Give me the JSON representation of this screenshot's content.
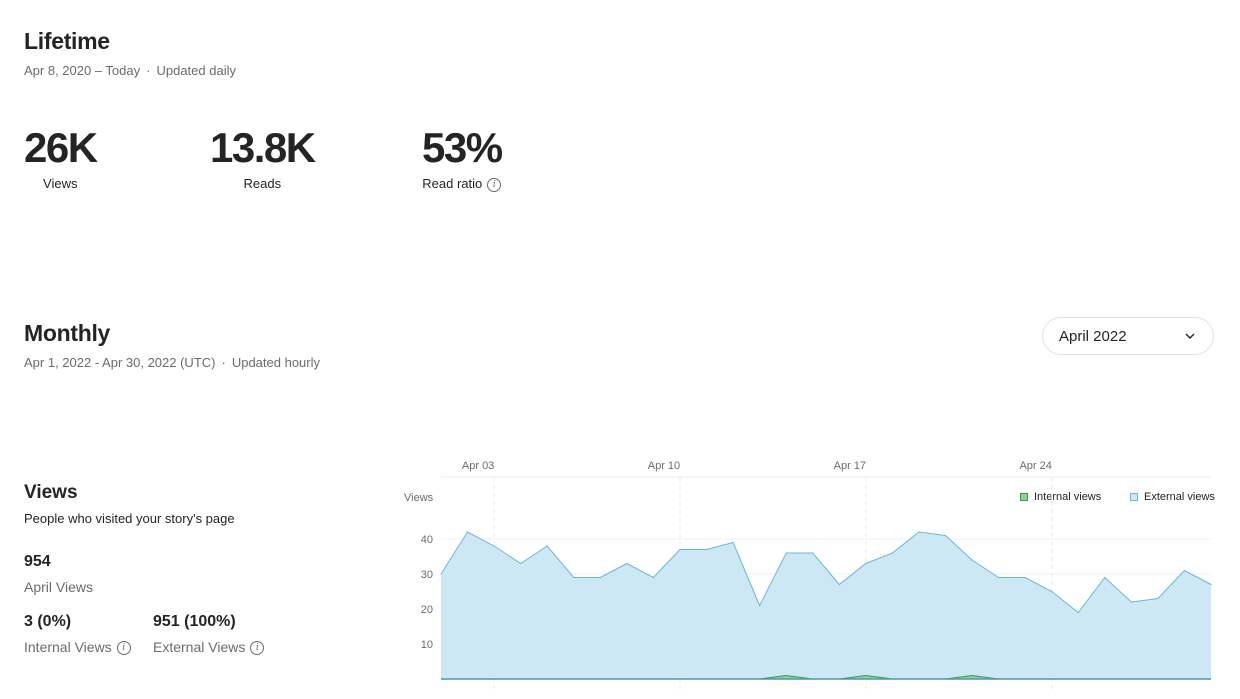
{
  "lifetime": {
    "title": "Lifetime",
    "range": "Apr 8, 2020 – Today",
    "update": "Updated daily",
    "views": {
      "value": "26K",
      "label": "Views"
    },
    "reads": {
      "value": "13.8K",
      "label": "Reads"
    },
    "ratio": {
      "value": "53%",
      "label": "Read ratio"
    }
  },
  "monthly": {
    "title": "Monthly",
    "range": "Apr 1, 2022 - Apr 30, 2022 (UTC)",
    "update": "Updated hourly",
    "month_select": "April 2022"
  },
  "views_panel": {
    "title": "Views",
    "desc": "People who visited your story's page",
    "total": "954",
    "total_label": "April Views",
    "internal": "3 (0%)",
    "internal_label": "Internal Views",
    "external": "951 (100%)",
    "external_label": "External Views"
  },
  "colors": {
    "internal": "#8fd19e",
    "internal_stroke": "#3a9a4f",
    "external": "#cde8f4",
    "external_stroke": "#6db6d6"
  },
  "chart_data": {
    "type": "area",
    "ylabel": "Views",
    "y_ticks": [
      10,
      20,
      30,
      40
    ],
    "ylim": [
      0,
      50
    ],
    "x_ticks": [
      {
        "day": 3,
        "label": "Apr 03"
      },
      {
        "day": 10,
        "label": "Apr 10"
      },
      {
        "day": 17,
        "label": "Apr 17"
      },
      {
        "day": 24,
        "label": "Apr 24"
      }
    ],
    "x_range": [
      1,
      30
    ],
    "legend_position": "top-right",
    "series": [
      {
        "name": "Internal views",
        "days": [
          1,
          2,
          3,
          4,
          5,
          6,
          7,
          8,
          9,
          10,
          11,
          12,
          13,
          14,
          15,
          16,
          17,
          18,
          19,
          20,
          21,
          22,
          23,
          24,
          25,
          26,
          27,
          28,
          29,
          30
        ],
        "values": [
          0,
          0,
          0,
          0,
          0,
          0,
          0,
          0,
          0,
          0,
          0,
          0,
          0,
          1,
          0,
          0,
          1,
          0,
          0,
          0,
          1,
          0,
          0,
          0,
          0,
          0,
          0,
          0,
          0,
          0
        ]
      },
      {
        "name": "External views",
        "days": [
          1,
          2,
          3,
          4,
          5,
          6,
          7,
          8,
          9,
          10,
          11,
          12,
          13,
          14,
          15,
          16,
          17,
          18,
          19,
          20,
          21,
          22,
          23,
          24,
          25,
          26,
          27,
          28,
          29,
          30
        ],
        "values": [
          30,
          42,
          38,
          33,
          38,
          29,
          29,
          33,
          29,
          37,
          37,
          39,
          21,
          36,
          36,
          27,
          33,
          36,
          42,
          41,
          34,
          29,
          29,
          25,
          19,
          29,
          22,
          23,
          31,
          27
        ]
      }
    ]
  }
}
